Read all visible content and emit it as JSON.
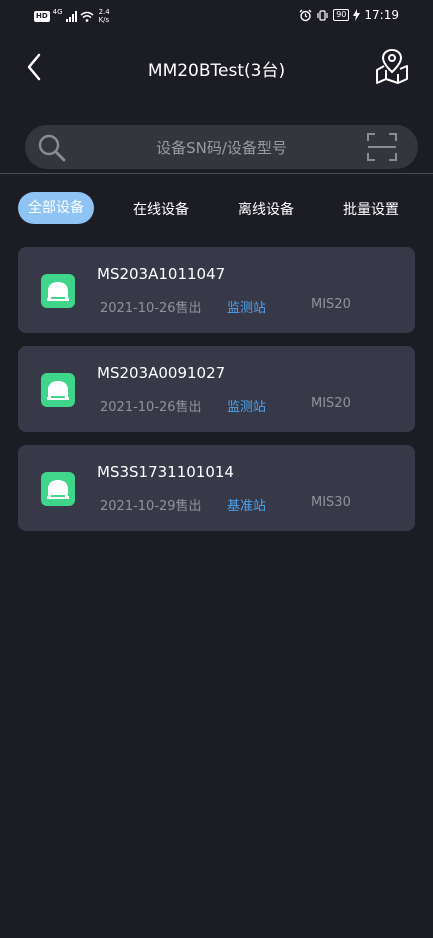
{
  "status_bar": {
    "hd_badge": "HD",
    "network_type": "4G",
    "speed_value": "2.4",
    "speed_unit": "K/s",
    "battery": "90",
    "time": "17:19"
  },
  "header": {
    "title": "MM20BTest(3台)",
    "back_icon": "chevron-left-icon",
    "map_icon": "map-location-icon"
  },
  "search": {
    "placeholder": "设备SN码/设备型号",
    "search_icon": "search-icon",
    "scan_icon": "scan-icon"
  },
  "tabs": [
    {
      "label": "全部设备",
      "active": true
    },
    {
      "label": "在线设备",
      "active": false
    },
    {
      "label": "离线设备",
      "active": false
    },
    {
      "label": "批量设置",
      "active": false
    }
  ],
  "devices": [
    {
      "sn": "MS203A1011047",
      "date": "2021-10-26售出",
      "type": "监测站",
      "model": "MIS20"
    },
    {
      "sn": "MS203A0091027",
      "date": "2021-10-26售出",
      "type": "监测站",
      "model": "MIS20"
    },
    {
      "sn": "MS3S1731101014",
      "date": "2021-10-29售出",
      "type": "基准站",
      "model": "MIS30"
    }
  ],
  "colors": {
    "background": "#1c1c25",
    "card": "#373948",
    "accent_tab": "#8fc3f3",
    "station_link": "#4aa3f0",
    "device_icon": "#3fd58a"
  }
}
